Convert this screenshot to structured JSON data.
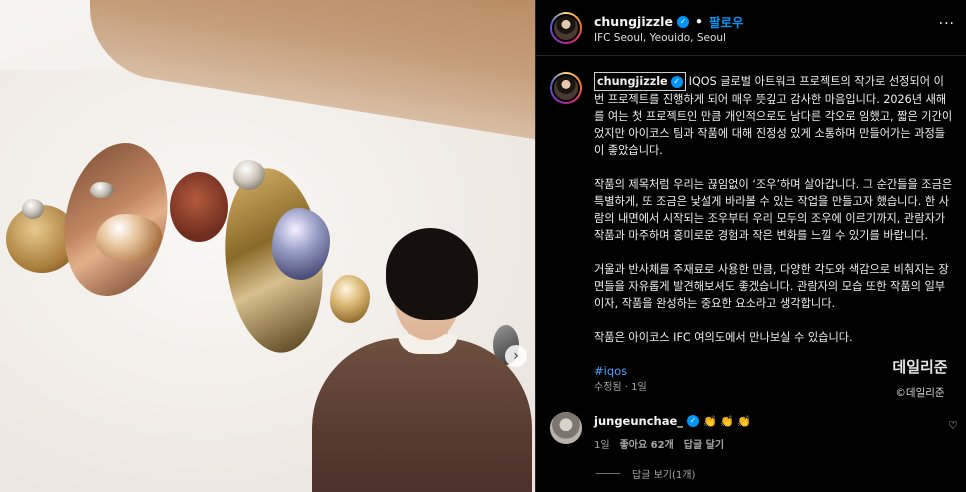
{
  "post": {
    "username": "chungjizzle",
    "follow_label": "팔로우",
    "separator": "•",
    "location": "IFC Seoul, Yeouido, Seoul",
    "more_label": "···"
  },
  "caption": {
    "username": "chungjizzle",
    "paragraphs": [
      "IQOS 글로벌 아트워크 프로젝트의 작가로 선정되어 이번 프로젝트를 진행하게 되어 매우 뜻깊고 감사한 마음입니다. 2026년 새해를 여는 첫 프로젝트인 만큼 개인적으로도 남다른 각오로 임했고, 짧은 기간이었지만 아이코스 팀과 작품에 대해 진정성 있게 소통하며 만들어가는 과정들이 좋았습니다.",
      "작품의 제목처럼 우리는 끊임없이 ‘조우’하며 살아갑니다. 그 순간들을 조금은 특별하게, 또 조금은 낯설게 바라볼 수 있는 작업을 만들고자 했습니다. 한 사람의 내면에서 시작되는 조우부터 우리 모두의 조우에 이르기까지, 관람자가 작품과 마주하며 흥미로운 경험과 작은 변화를 느낄 수 있기를 바랍니다.",
      "거울과 반사체를 주재료로 사용한 만큼, 다양한 각도와 색감으로 비춰지는 장면들을 자유롭게 발견해보셔도 좋겠습니다. 관람자의 모습 또한 작품의 일부이자, 작품을 완성하는 중요한 요소라고 생각합니다.",
      "작품은 아이코스 IFC 여의도에서 만나보실 수 있습니다."
    ],
    "hashtag": "#iqos",
    "meta": "수정됨 · 1일"
  },
  "watermark": {
    "title": "데일리준",
    "copyright": "©데일리준"
  },
  "comment": {
    "username": "jungeunchae_",
    "text": "👏 👏 👏",
    "time": "1일",
    "likes": "좋아요 62개",
    "reply_label": "답글 달기",
    "like_icon": "♡",
    "view_replies": "답글 보기(1개)"
  },
  "carousel": {
    "next_label": "›"
  }
}
